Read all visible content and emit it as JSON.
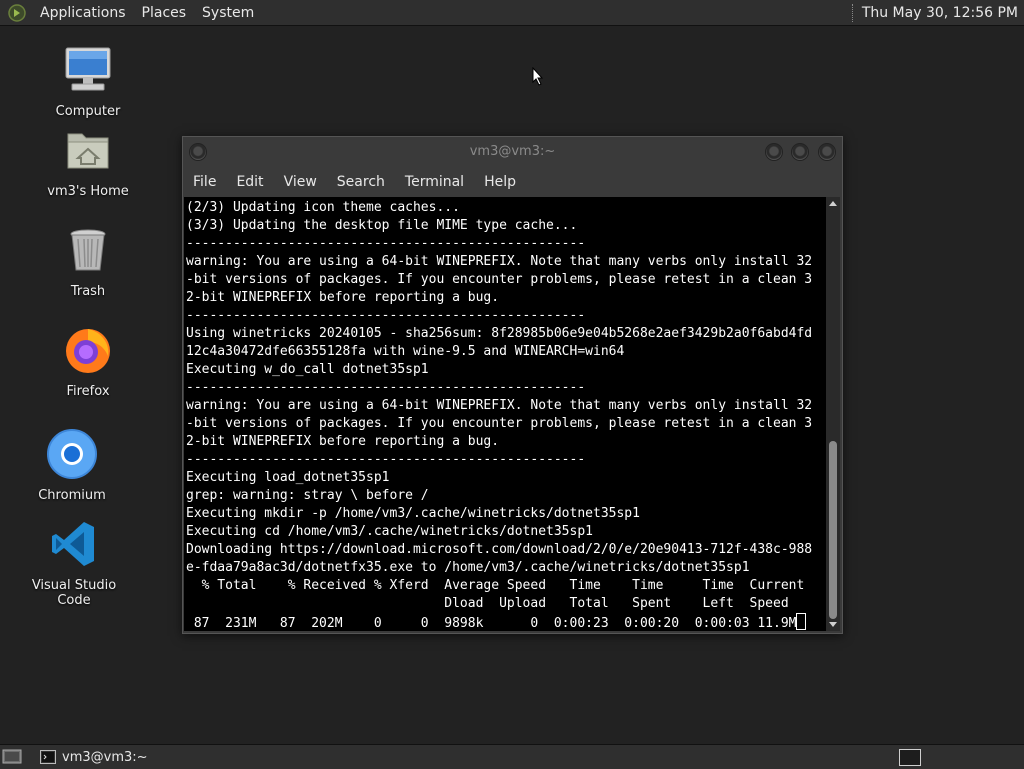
{
  "top_panel": {
    "menus": [
      "Applications",
      "Places",
      "System"
    ],
    "clock": "Thu May 30, 12:56 PM"
  },
  "desktop_icons": [
    {
      "label": "Computer",
      "icon": "computer-icon"
    },
    {
      "label": "vm3's Home",
      "icon": "home-folder-icon"
    },
    {
      "label": "Trash",
      "icon": "trash-icon"
    },
    {
      "label": "Firefox",
      "icon": "firefox-icon"
    },
    {
      "label": "Chromium",
      "icon": "chromium-icon"
    },
    {
      "label": "Visual Studio Code",
      "icon": "vscode-icon"
    }
  ],
  "terminal": {
    "title": "vm3@vm3:~",
    "menu": [
      "File",
      "Edit",
      "View",
      "Search",
      "Terminal",
      "Help"
    ],
    "lines": [
      "(2/3) Updating icon theme caches...",
      "(3/3) Updating the desktop file MIME type cache...",
      "---------------------------------------------------",
      "warning: You are using a 64-bit WINEPREFIX. Note that many verbs only install 32",
      "-bit versions of packages. If you encounter problems, please retest in a clean 3",
      "2-bit WINEPREFIX before reporting a bug.",
      "---------------------------------------------------",
      "Using winetricks 20240105 - sha256sum: 8f28985b06e9e04b5268e2aef3429b2a0f6abd4fd",
      "12c4a30472dfe66355128fa with wine-9.5 and WINEARCH=win64",
      "Executing w_do_call dotnet35sp1",
      "---------------------------------------------------",
      "warning: You are using a 64-bit WINEPREFIX. Note that many verbs only install 32",
      "-bit versions of packages. If you encounter problems, please retest in a clean 3",
      "2-bit WINEPREFIX before reporting a bug.",
      "---------------------------------------------------",
      "Executing load_dotnet35sp1",
      "grep: warning: stray \\ before /",
      "Executing mkdir -p /home/vm3/.cache/winetricks/dotnet35sp1",
      "Executing cd /home/vm3/.cache/winetricks/dotnet35sp1",
      "Downloading https://download.microsoft.com/download/2/0/e/20e90413-712f-438c-988",
      "e-fdaa79a8ac3d/dotnetfx35.exe to /home/vm3/.cache/winetricks/dotnet35sp1",
      "  % Total    % Received % Xferd  Average Speed   Time    Time     Time  Current",
      "                                 Dload  Upload   Total   Spent    Left  Speed",
      " 87  231M   87  202M    0     0  9898k      0  0:00:23  0:00:20  0:00:03 11.9M"
    ],
    "scroll_position": 0.62
  },
  "bottom_panel": {
    "task_label": "vm3@vm3:~"
  },
  "colors": {
    "desktop_bg": "#222222",
    "panel_bg": "#2f2f2f",
    "terminal_bg": "#000000",
    "terminal_fg": "#ffffff"
  }
}
